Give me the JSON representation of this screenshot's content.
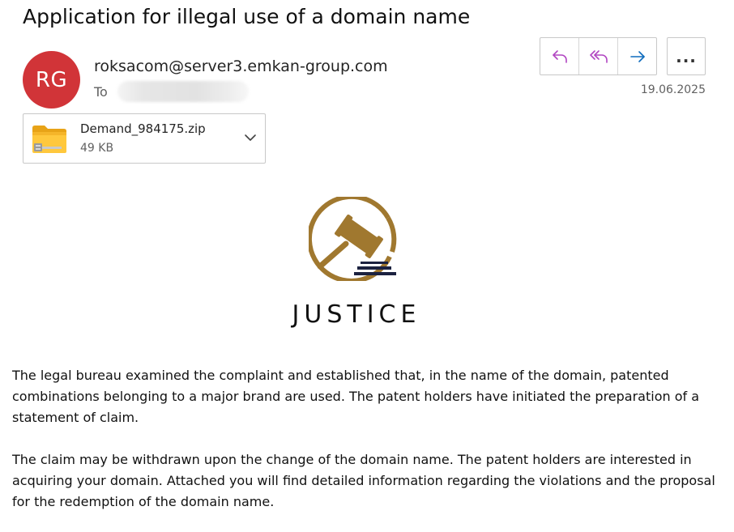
{
  "email": {
    "subject": "Application for illegal use of a domain name",
    "sender": {
      "initials": "RG",
      "avatar_color": "#d13438",
      "address": "roksacom@server3.emkan-group.com"
    },
    "to_label": "To",
    "date": "19.06.2025",
    "actions": {
      "reply_icon": "reply-icon",
      "reply_all_icon": "reply-all-icon",
      "forward_icon": "forward-icon",
      "more_label": "..."
    },
    "attachment": {
      "name": "Demand_984175.zip",
      "size": "49 KB",
      "icon": "zip-folder-icon"
    },
    "logo": {
      "text": "JUSTICE",
      "gold_color": "#a0782f",
      "dark_color": "#1c2240"
    },
    "body": {
      "paragraph1": "The legal bureau examined the complaint and established that, in the name of the domain, patented combinations belonging to a major brand are used. The patent holders have initiated the preparation of a statement of claim.",
      "paragraph2": "The claim may be withdrawn upon the change of the domain name. The patent holders are interested in acquiring your domain. Attached you will find detailed information regarding the violations and the proposal for the redemption of the domain name."
    }
  }
}
